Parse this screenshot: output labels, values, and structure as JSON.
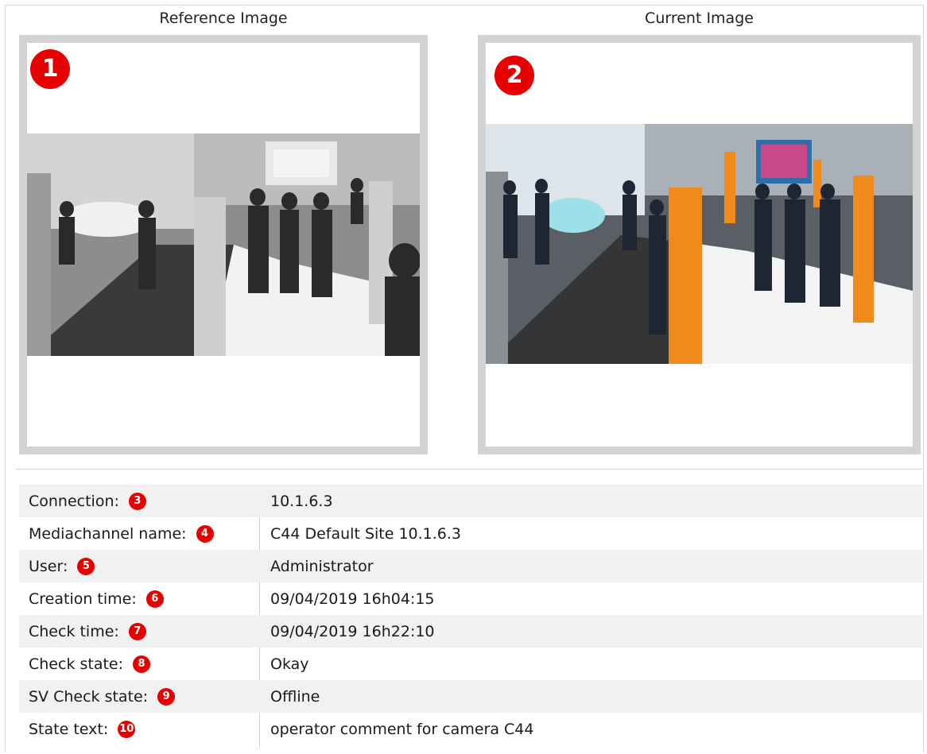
{
  "images": {
    "reference": {
      "title": "Reference Image",
      "badge": "1",
      "mode": "grayscale"
    },
    "current": {
      "title": "Current Image",
      "badge": "2",
      "mode": "color"
    }
  },
  "details": [
    {
      "label": "Connection:",
      "badge": "3",
      "value": "10.1.6.3"
    },
    {
      "label": "Mediachannel name:",
      "badge": "4",
      "value": "C44 Default Site 10.1.6.3"
    },
    {
      "label": "User:",
      "badge": "5",
      "value": "Administrator"
    },
    {
      "label": "Creation time:",
      "badge": "6",
      "value": "09/04/2019 16h04:15"
    },
    {
      "label": "Check time:",
      "badge": "7",
      "value": "09/04/2019 16h22:10"
    },
    {
      "label": "Check state:",
      "badge": "8",
      "value": "Okay"
    },
    {
      "label": "SV Check state:",
      "badge": "9",
      "value": "Offline"
    },
    {
      "label": "State text:",
      "badge": "10",
      "value": "operator comment for camera C44"
    }
  ],
  "colors": {
    "badge": "#e60000",
    "accent_orange": "#f08a1a",
    "frame_border": "#d3d3d3"
  }
}
